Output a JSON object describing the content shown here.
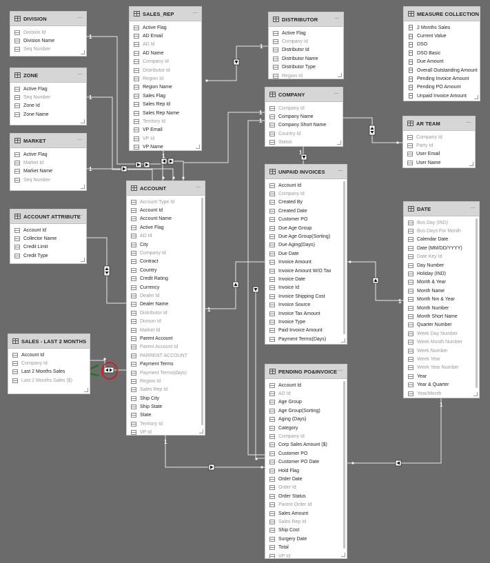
{
  "tables": [
    {
      "id": "division",
      "title": "DIVISION",
      "fields": [
        [
          "Division Id",
          0
        ],
        [
          "Division Name",
          1
        ],
        [
          "Seq Number",
          0
        ]
      ]
    },
    {
      "id": "zone",
      "title": "ZONE",
      "fields": [
        [
          "Active Flag",
          1
        ],
        [
          "Seq Number",
          0
        ],
        [
          "Zone Id",
          1
        ],
        [
          "Zone Name",
          1
        ]
      ]
    },
    {
      "id": "market",
      "title": "MARKET",
      "fields": [
        [
          "Active Flag",
          1
        ],
        [
          "Market Id",
          0
        ],
        [
          "Market Name",
          1
        ],
        [
          "Seq Number",
          0
        ]
      ]
    },
    {
      "id": "account_attribute",
      "title": "ACCOUNT ATTRIBUTE",
      "fields": [
        [
          "Account Id",
          1
        ],
        [
          "Collector Name",
          1
        ],
        [
          "Credit Limit",
          1
        ],
        [
          "Credit Type",
          1
        ]
      ]
    },
    {
      "id": "sales_last2",
      "title": "SALES - LAST 2 MONTHS",
      "fields": [
        [
          "Account Id",
          1
        ],
        [
          "Company Id",
          0
        ],
        [
          "Last 2 Months Sales",
          1
        ],
        [
          "Last 2 Months Sales ($)",
          0
        ]
      ]
    },
    {
      "id": "sales_rep",
      "title": "SALES_REP",
      "fields": [
        [
          "Active Flag",
          1
        ],
        [
          "AD Email",
          1
        ],
        [
          "AD Id",
          0
        ],
        [
          "AD Name",
          1
        ],
        [
          "Company Id",
          0
        ],
        [
          "Distributor Id",
          0
        ],
        [
          "Region Id",
          0
        ],
        [
          "Region Name",
          1
        ],
        [
          "Sales Flag",
          1
        ],
        [
          "Sales Rep Id",
          1
        ],
        [
          "Sales Rep Name",
          1
        ],
        [
          "Territory Id",
          0
        ],
        [
          "VP Email",
          1
        ],
        [
          "VP Id",
          0
        ],
        [
          "VP Name",
          1
        ]
      ]
    },
    {
      "id": "account",
      "title": "ACCOUNT",
      "fields": [
        [
          "Account Type Id",
          0
        ],
        [
          "Account Id",
          1
        ],
        [
          "Account Name",
          1
        ],
        [
          "Active Flag",
          1
        ],
        [
          "AD Id",
          0
        ],
        [
          "City",
          1
        ],
        [
          "Company Id",
          0
        ],
        [
          "Contract",
          1
        ],
        [
          "Country",
          1
        ],
        [
          "Credit Rating",
          1
        ],
        [
          "Currency",
          1
        ],
        [
          "Dealer Id",
          0
        ],
        [
          "Dealer Name",
          1
        ],
        [
          "Distributor Id",
          0
        ],
        [
          "Divison Id",
          0
        ],
        [
          "Market Id",
          0
        ],
        [
          "Parent Account",
          1
        ],
        [
          "Parent Account Id",
          0
        ],
        [
          "PARRENT ACCOUNT",
          0
        ],
        [
          "Payment Terms",
          1
        ],
        [
          "Payment Terms(days)",
          0
        ],
        [
          "Region Id",
          0
        ],
        [
          "Sales Rep Id",
          0
        ],
        [
          "Ship City",
          1
        ],
        [
          "Ship State",
          1
        ],
        [
          "State",
          1
        ],
        [
          "Territory Id",
          0
        ],
        [
          "VP Id",
          0
        ]
      ]
    },
    {
      "id": "distributor",
      "title": "DISTRIBUTOR",
      "fields": [
        [
          "Active Flag",
          1
        ],
        [
          "Company Id",
          0
        ],
        [
          "Distributor Id",
          1
        ],
        [
          "Distributor Name",
          1
        ],
        [
          "Distributor Type",
          1
        ],
        [
          "Region Id",
          0
        ]
      ]
    },
    {
      "id": "company",
      "title": "COMPANY",
      "fields": [
        [
          "Company Id",
          0
        ],
        [
          "Company Name",
          1
        ],
        [
          "Company Short Name",
          1
        ],
        [
          "Country Id",
          0
        ],
        [
          "Status",
          0
        ]
      ]
    },
    {
      "id": "unpaid",
      "title": "UNPAID INVOICES",
      "fields": [
        [
          "Account Id",
          1
        ],
        [
          "Company Id",
          0
        ],
        [
          "Created By",
          1
        ],
        [
          "Created Date",
          1
        ],
        [
          "Customer PO",
          1
        ],
        [
          "Due Age Group",
          1
        ],
        [
          "Due Age Group(Sorting)",
          1
        ],
        [
          "Due Aging(Days)",
          1
        ],
        [
          "Due Date",
          1
        ],
        [
          "Invoice Amount",
          1
        ],
        [
          "Invoice Amount W/O Tax",
          1
        ],
        [
          "Invoice Date",
          1
        ],
        [
          "Invoice Id",
          1
        ],
        [
          "Invoice Shipping Cost",
          1
        ],
        [
          "Invoice Source",
          1
        ],
        [
          "Invoice Tax Amount",
          1
        ],
        [
          "Invoice Type",
          1
        ],
        [
          "Paid Invoice Amount",
          1
        ],
        [
          "Payment Terms(Days)",
          1
        ]
      ]
    },
    {
      "id": "pending",
      "title": "PENDING PO&INVOICE",
      "fields": [
        [
          "Account Id",
          1
        ],
        [
          "AD Id",
          0
        ],
        [
          "Age Group",
          1
        ],
        [
          "Age Group(Sorting)",
          1
        ],
        [
          "Aging (Days)",
          1
        ],
        [
          "Category",
          1
        ],
        [
          "Company Id",
          0
        ],
        [
          "Corp Sales Amount ($)",
          1
        ],
        [
          "Customer PO",
          1
        ],
        [
          "Customer PO Date",
          1
        ],
        [
          "Hold Flag",
          1
        ],
        [
          "Order Date",
          1
        ],
        [
          "Order Id",
          0
        ],
        [
          "Order Status",
          1
        ],
        [
          "Parent Order Id",
          0
        ],
        [
          "Sales Amount",
          1
        ],
        [
          "Sales Rep Id",
          0
        ],
        [
          "Ship Cost",
          1
        ],
        [
          "Surgery Date",
          1
        ],
        [
          "Total",
          1
        ],
        [
          "VP Id",
          0
        ]
      ]
    },
    {
      "id": "measures",
      "title": "MEASURE COLLECTION",
      "measure": true,
      "fields": [
        [
          "2 Months Sales",
          1
        ],
        [
          "Current Value",
          1
        ],
        [
          "DSO",
          1
        ],
        [
          "DSO Basic",
          1
        ],
        [
          "Due Amount",
          1
        ],
        [
          "Overall Outstanding Amount",
          1
        ],
        [
          "Pending Invoice Amount",
          1
        ],
        [
          "Pending PO Amount",
          1
        ],
        [
          "Unpaid Invoice Amount",
          1
        ]
      ]
    },
    {
      "id": "ar_team",
      "title": "AR TEAM",
      "fields": [
        [
          "Company Id",
          0
        ],
        [
          "Party Id",
          0
        ],
        [
          "User Email",
          1
        ],
        [
          "User Name",
          1
        ]
      ]
    },
    {
      "id": "date",
      "title": "DATE",
      "fields": [
        [
          "Bus Day (IND)",
          0
        ],
        [
          "Bus Days For Month",
          0
        ],
        [
          "Calendar Date",
          1
        ],
        [
          "Date (MM/DD/YYYY)",
          1
        ],
        [
          "Date Key Id",
          0
        ],
        [
          "Day Number",
          1
        ],
        [
          "Holiday (IND)",
          1
        ],
        [
          "Month & Year",
          1
        ],
        [
          "Month Name",
          1
        ],
        [
          "Month Nm & Year",
          1
        ],
        [
          "Month Number",
          1
        ],
        [
          "Month Short Name",
          1
        ],
        [
          "Quarter Number",
          1
        ],
        [
          "Week Day Number",
          0
        ],
        [
          "Week Month Number",
          0
        ],
        [
          "Week Number",
          0
        ],
        [
          "Week Year",
          0
        ],
        [
          "Week Year Number",
          0
        ],
        [
          "Year",
          1
        ],
        [
          "Year & Quarter",
          1
        ],
        [
          "Year/Month",
          0
        ]
      ]
    }
  ],
  "cardinality": {
    "one": "1",
    "many": "*"
  }
}
